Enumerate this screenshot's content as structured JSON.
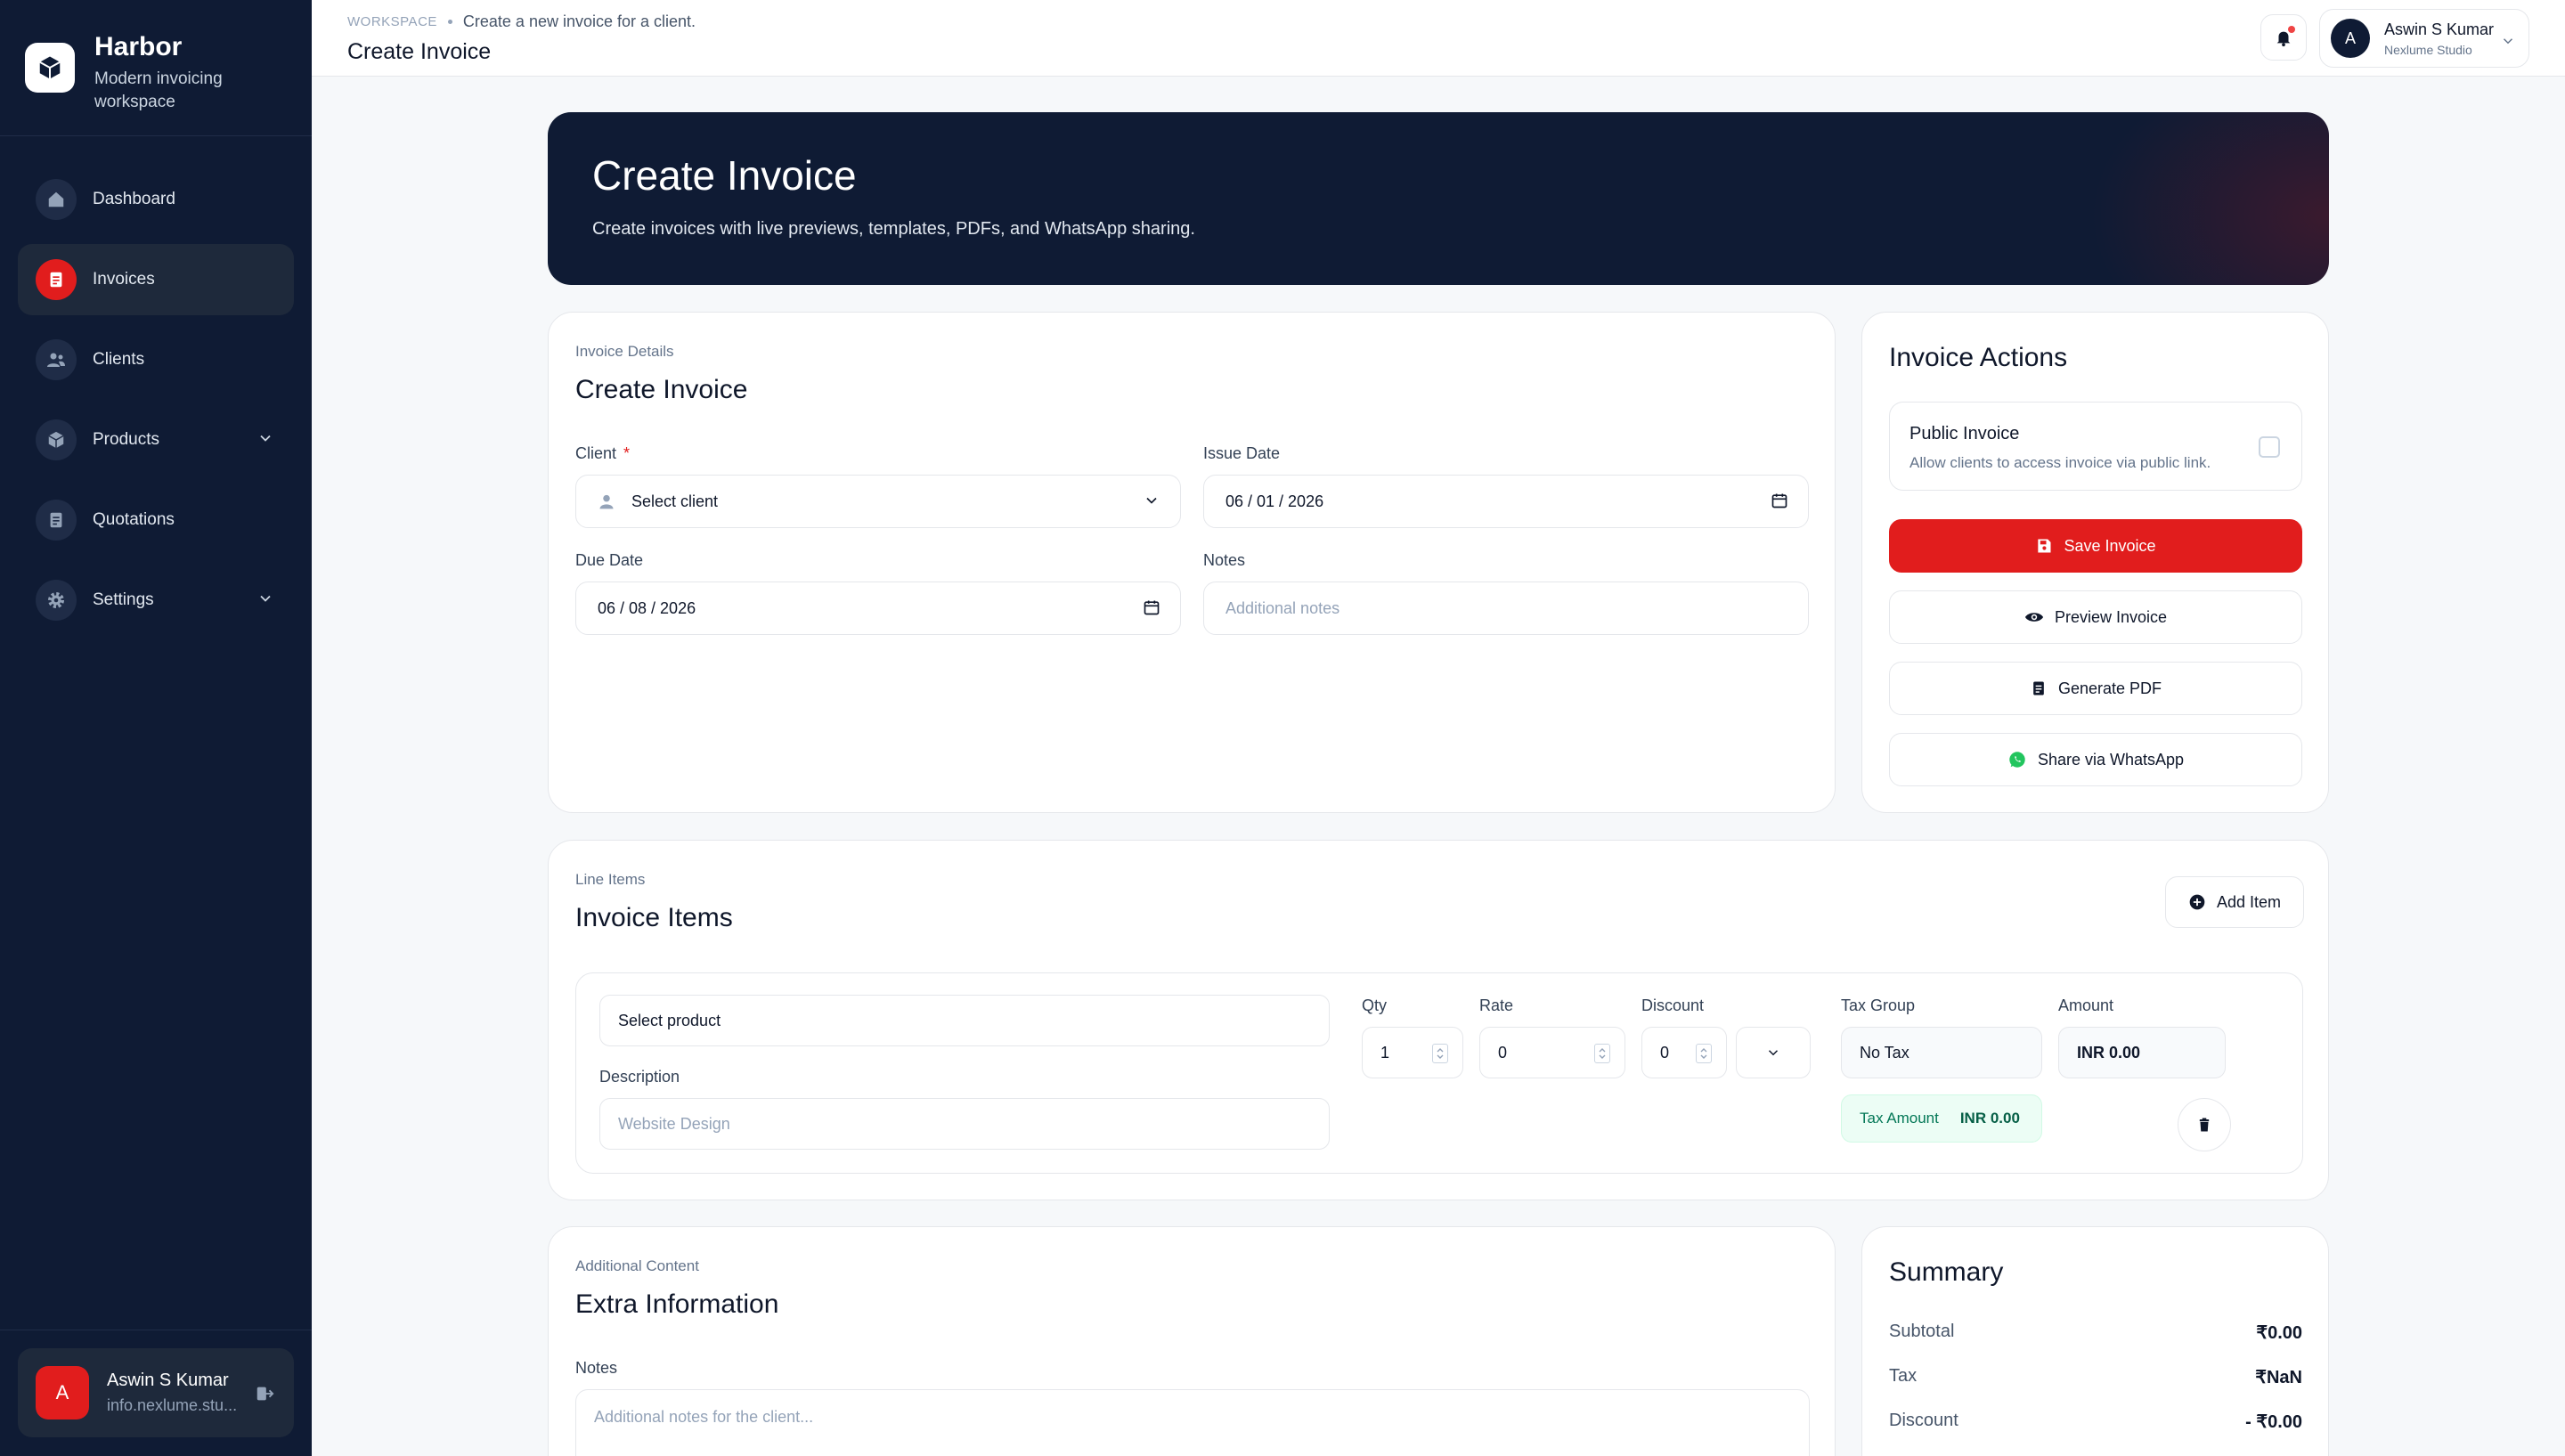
{
  "app": {
    "name": "Harbor",
    "tagline": "Modern invoicing workspace"
  },
  "sidebar": {
    "items": [
      {
        "label": "Dashboard",
        "icon": "home-icon"
      },
      {
        "label": "Invoices",
        "icon": "invoice-icon",
        "active": true
      },
      {
        "label": "Clients",
        "icon": "users-icon"
      },
      {
        "label": "Products",
        "icon": "box-icon",
        "expandable": true
      },
      {
        "label": "Quotations",
        "icon": "document-icon"
      },
      {
        "label": "Settings",
        "icon": "gear-icon",
        "expandable": true
      }
    ],
    "user": {
      "initial": "A",
      "name": "Aswin S Kumar",
      "email": "info.nexlume.stu..."
    }
  },
  "topbar": {
    "crumb_root": "WORKSPACE",
    "crumb_desc": "Create a new invoice for a client.",
    "title": "Create Invoice",
    "user": {
      "initial": "A",
      "name": "Aswin S Kumar",
      "org": "Nexlume Studio"
    }
  },
  "hero": {
    "title": "Create Invoice",
    "subtitle": "Create invoices with live previews, templates, PDFs, and WhatsApp sharing."
  },
  "details": {
    "eyebrow": "Invoice Details",
    "title": "Create Invoice",
    "client_label": "Client",
    "client_required": "*",
    "client_value": "Select client",
    "issue_label": "Issue Date",
    "issue_value": "06 / 01 / 2026",
    "due_label": "Due Date",
    "due_value": "06 / 08 / 2026",
    "notes_label": "Notes",
    "notes_placeholder": "Additional notes"
  },
  "actions": {
    "title": "Invoice Actions",
    "public_title": "Public Invoice",
    "public_sub": "Allow clients to access invoice via public link.",
    "public_checked": false,
    "save": "Save Invoice",
    "preview": "Preview Invoice",
    "pdf": "Generate PDF",
    "whatsapp": "Share via WhatsApp"
  },
  "items": {
    "eyebrow": "Line Items",
    "title": "Invoice Items",
    "add_label": "Add Item",
    "row": {
      "product_value": "Select product",
      "description_label": "Description",
      "description_placeholder": "Website Design",
      "qty_label": "Qty",
      "qty_value": "1",
      "rate_label": "Rate",
      "rate_value": "0",
      "discount_label": "Discount",
      "discount_value": "0",
      "tax_group_label": "Tax Group",
      "tax_group_value": "No Tax",
      "amount_label": "Amount",
      "amount_value": "INR 0.00",
      "tax_amount_label": "Tax Amount",
      "tax_amount_value": "INR 0.00"
    }
  },
  "extra": {
    "eyebrow": "Additional Content",
    "title": "Extra Information",
    "notes_label": "Notes",
    "notes_placeholder": "Additional notes for the client..."
  },
  "summary": {
    "title": "Summary",
    "rows": [
      {
        "label": "Subtotal",
        "value": "₹0.00"
      },
      {
        "label": "Tax",
        "value": "₹NaN"
      },
      {
        "label": "Discount",
        "value": "- ₹0.00"
      }
    ]
  },
  "colors": {
    "sidebar_bg": "#0f1b34",
    "accent_red": "#e11d1d",
    "success_green": "#047857"
  }
}
